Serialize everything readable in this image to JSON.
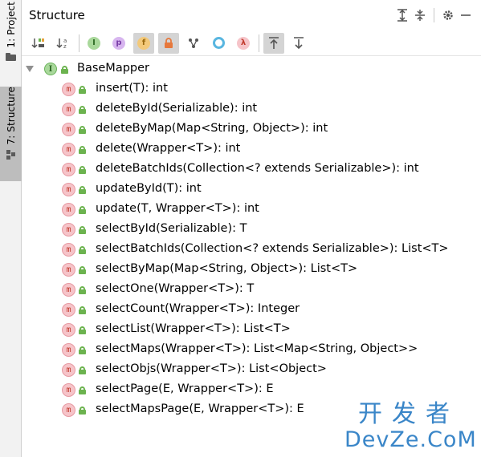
{
  "sidebar": {
    "project_tab": "1: Project",
    "structure_tab": "7: Structure"
  },
  "panel": {
    "title": "Structure"
  },
  "toolbar": {
    "visibility_letters": {
      "protected": "p",
      "field": "f",
      "lambda": "λ"
    }
  },
  "tree": {
    "root": {
      "icon_letter": "I",
      "label": "BaseMapper"
    },
    "method_icon_letter": "m",
    "methods": [
      "insert(T): int",
      "deleteById(Serializable): int",
      "deleteByMap(Map<String, Object>): int",
      "delete(Wrapper<T>): int",
      "deleteBatchIds(Collection<? extends Serializable>): int",
      "updateById(T): int",
      "update(T, Wrapper<T>): int",
      "selectById(Serializable): T",
      "selectBatchIds(Collection<? extends Serializable>): List<T>",
      "selectByMap(Map<String, Object>): List<T>",
      "selectOne(Wrapper<T>): T",
      "selectCount(Wrapper<T>): Integer",
      "selectList(Wrapper<T>): List<T>",
      "selectMaps(Wrapper<T>): List<Map<String, Object>>",
      "selectObjs(Wrapper<T>): List<Object>",
      "selectPage(E, Wrapper<T>): E",
      "selectMapsPage(E, Wrapper<T>): E"
    ]
  },
  "watermark": {
    "chinese": "开发者",
    "english": "DevZe.CoM"
  },
  "colors": {
    "accent_blue": "#3a86c8",
    "method_icon": "#f6c4c9",
    "interface_icon": "#a9d89b",
    "lock_green": "#6cb34f"
  }
}
